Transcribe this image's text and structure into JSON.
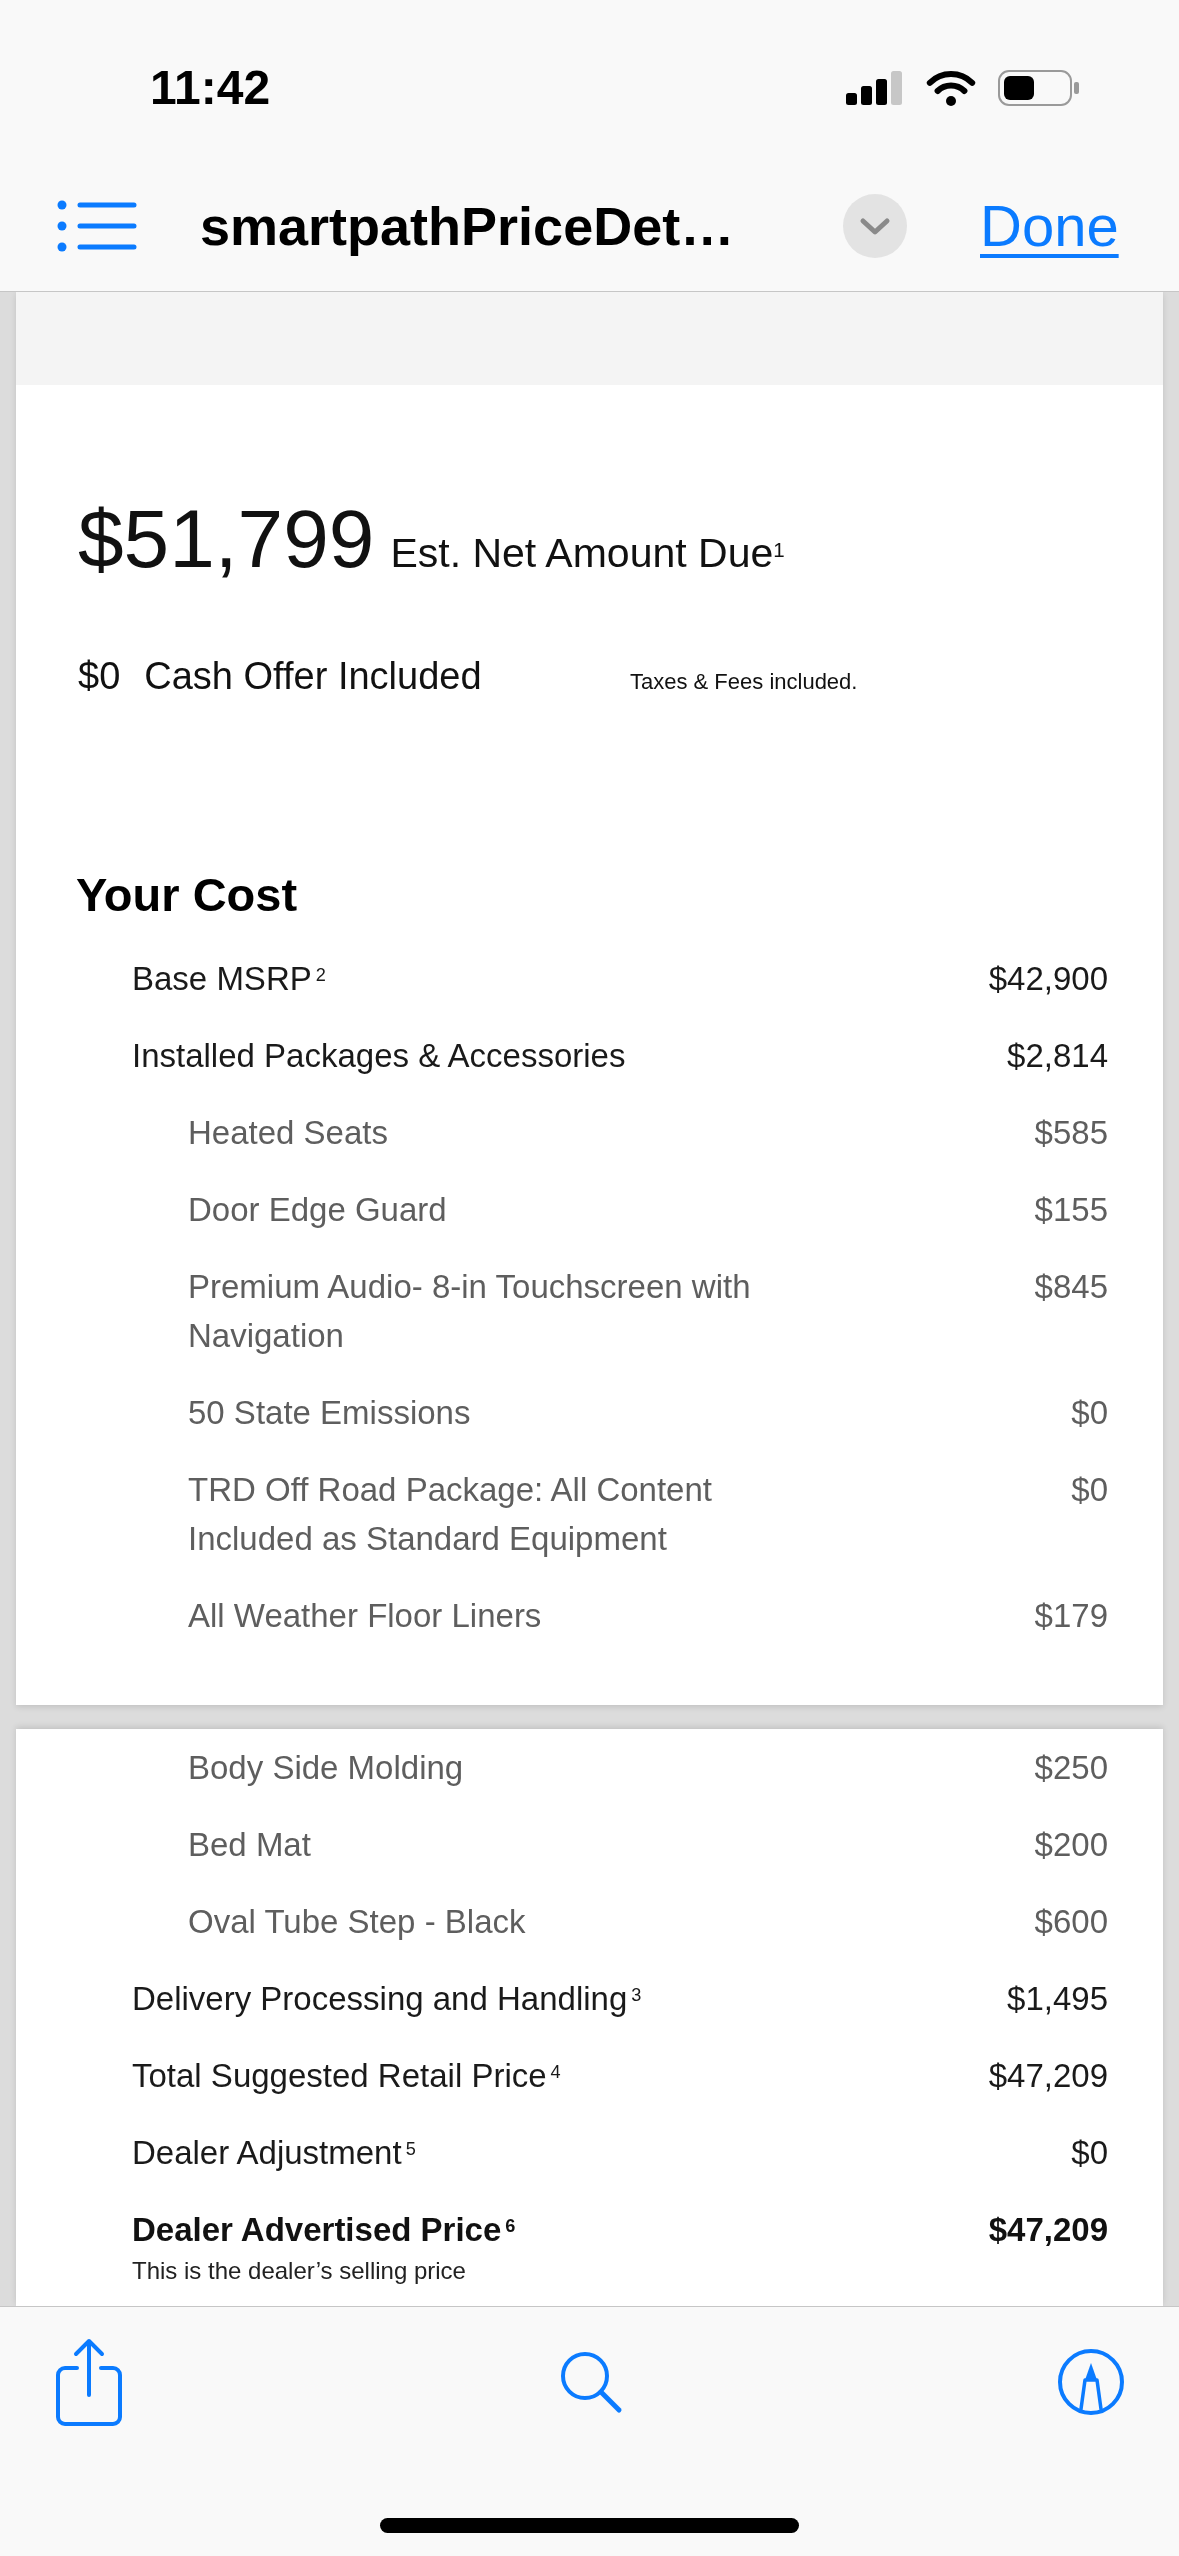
{
  "status_bar": {
    "time": "11:42"
  },
  "nav_bar": {
    "title": "smartpathPriceDet…",
    "done": "Done"
  },
  "summary": {
    "amount": "$51,799",
    "amount_label": "Est. Net Amount Due$^{1}$",
    "cash_offer_amount": "$0",
    "cash_offer_label": "Cash Offer Included",
    "taxes_note": "Taxes & Fees included."
  },
  "cost": {
    "title": "Your Cost",
    "pages": [
      {
        "rows": [
          {
            "kind": "line",
            "label": "Base MSRP$^{2}$",
            "value": "$42,900"
          },
          {
            "kind": "line",
            "label": "Installed Packages & Accessories",
            "value": "$2,814",
            "children": [
              {
                "label": "Heated Seats",
                "value": "$585"
              },
              {
                "label": "Door Edge Guard",
                "value": "$155"
              },
              {
                "label": "Premium Audio- 8-in Touchscreen with Navigation",
                "value": "$845"
              },
              {
                "label": "50 State Emissions",
                "value": "$0"
              },
              {
                "label": "TRD Off Road Package: All Content Included as Standard Equipment",
                "value": "$0"
              },
              {
                "label": "All Weather Floor Liners",
                "value": "$179"
              }
            ]
          }
        ]
      },
      {
        "rows": [
          {
            "kind": "continued",
            "children": [
              {
                "label": "Body Side Molding",
                "value": "$250"
              },
              {
                "label": "Bed Mat",
                "value": "$200"
              },
              {
                "label": "Oval Tube Step - Black",
                "value": "$600"
              }
            ]
          },
          {
            "kind": "line",
            "label": "Delivery Processing and Handling$^{3}$",
            "value": "$1,495"
          },
          {
            "kind": "line",
            "label": "Total Suggested Retail Price$^{4}$",
            "value": "$47,209"
          },
          {
            "kind": "line",
            "label": "Dealer Adjustment$^{5}$",
            "value": "$0"
          },
          {
            "kind": "total",
            "label": "Dealer Advertised Price$^{6}$",
            "value": "$47,209",
            "note": "This is the dealer’s selling price"
          }
        ]
      }
    ]
  }
}
